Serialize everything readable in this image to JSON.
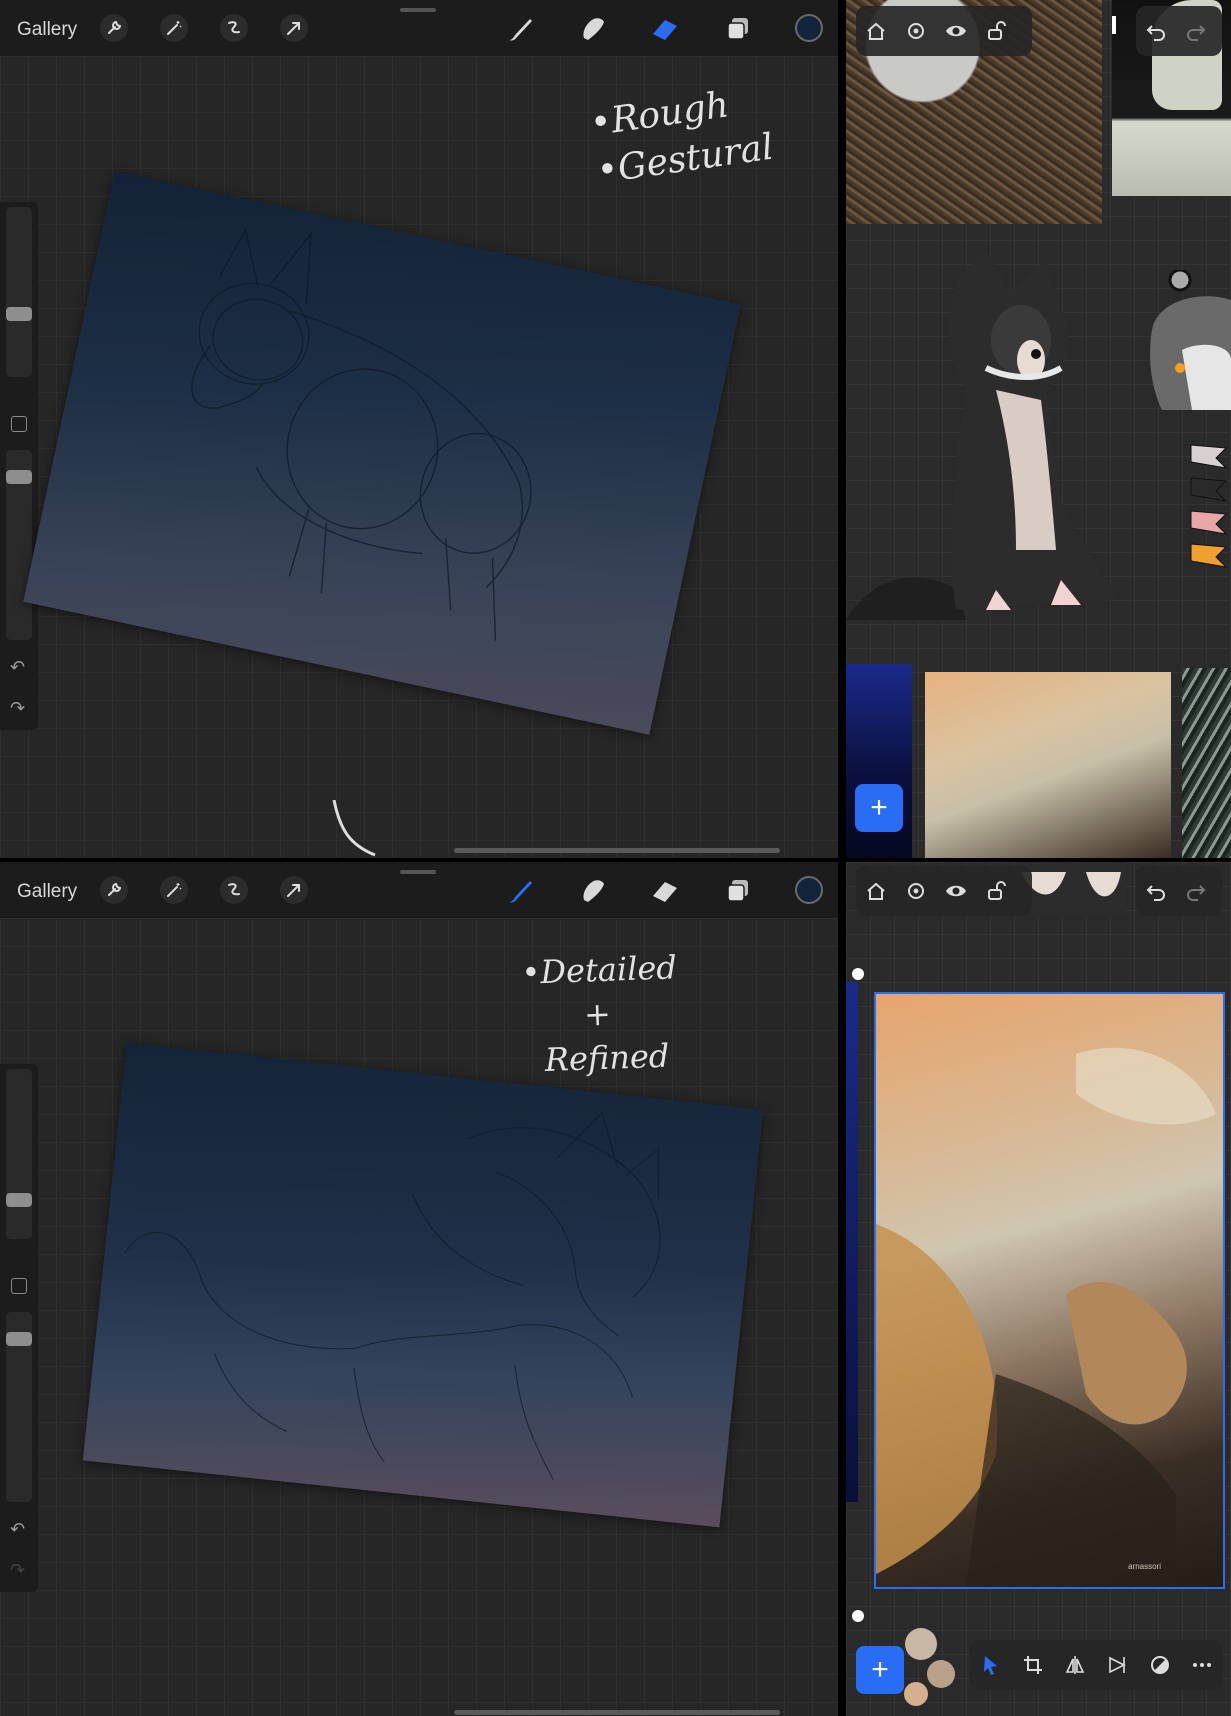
{
  "procreate_top": {
    "gallery_label": "Gallery",
    "note": "•Rough\n•Gestural",
    "undo_symbol": "↶",
    "redo_symbol": "↷"
  },
  "procreate_bottom": {
    "gallery_label": "Gallery",
    "note": "•Detailed\n      +\n  Refined",
    "undo_symbol": "↶",
    "redo_symbol": "↷"
  },
  "toolbar_icons": [
    "wrench-icon",
    "magic-wand-icon",
    "selection-icon",
    "transform-arrow-icon",
    "brush-icon",
    "smudge-icon",
    "eraser-icon",
    "layers-icon",
    "color-icon"
  ],
  "active_tool_top": "eraser",
  "active_tool_bottom": "brush",
  "current_color": "#12243a",
  "accent_color": "#2a6df5",
  "reference_toolbar_icons": [
    "home-icon",
    "settings-icon",
    "eye-icon",
    "lock-icon",
    "undo-icon",
    "redo-icon"
  ],
  "reference_bottom_tools": [
    "select-icon",
    "crop-icon",
    "flip-horizontal-icon",
    "flip-vertical-icon",
    "adjust-icon",
    "more-icon"
  ],
  "add_label": "+",
  "artwork_signature": "arnassori"
}
